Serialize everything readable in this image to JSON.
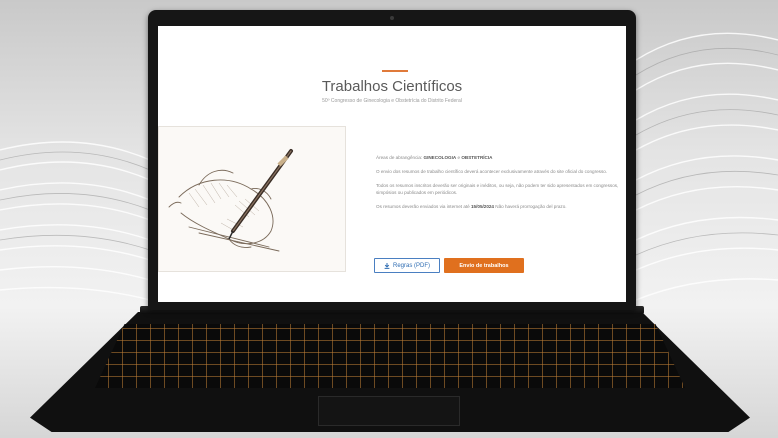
{
  "page": {
    "title": "Trabalhos Científicos",
    "subtitle": "50º Congresso de Ginecologia e Obstetrícia do Distrito Federal"
  },
  "info": {
    "areas_prefix": "Áreas de abrangência:",
    "areas_1": "GINECOLOGIA",
    "areas_join": "e",
    "areas_2": "OBSTETRÍCIA",
    "para_submission": "O envio dos resumos de trabalho científico deverá acontecer exclusivamente através do site oficial do congresso.",
    "para_original": "Todos os resumos inscritos deverão ser originais e inéditos, ou seja, não podem ter sido apresentados em congressos, simpósios ou publicados em periódicos.",
    "deadline_prefix": "Os resumos deverão enviados via internet até",
    "deadline_date": "15/05/2024",
    "deadline_suffix": "Não haverá prorrogação del prazo."
  },
  "buttons": {
    "rules_label": "Regras (PDF)",
    "rules_icon": "download-icon",
    "send_label": "Envio de trabalhos"
  },
  "colors": {
    "accent": "#e0701e",
    "rules_blue": "#2f6db3"
  }
}
